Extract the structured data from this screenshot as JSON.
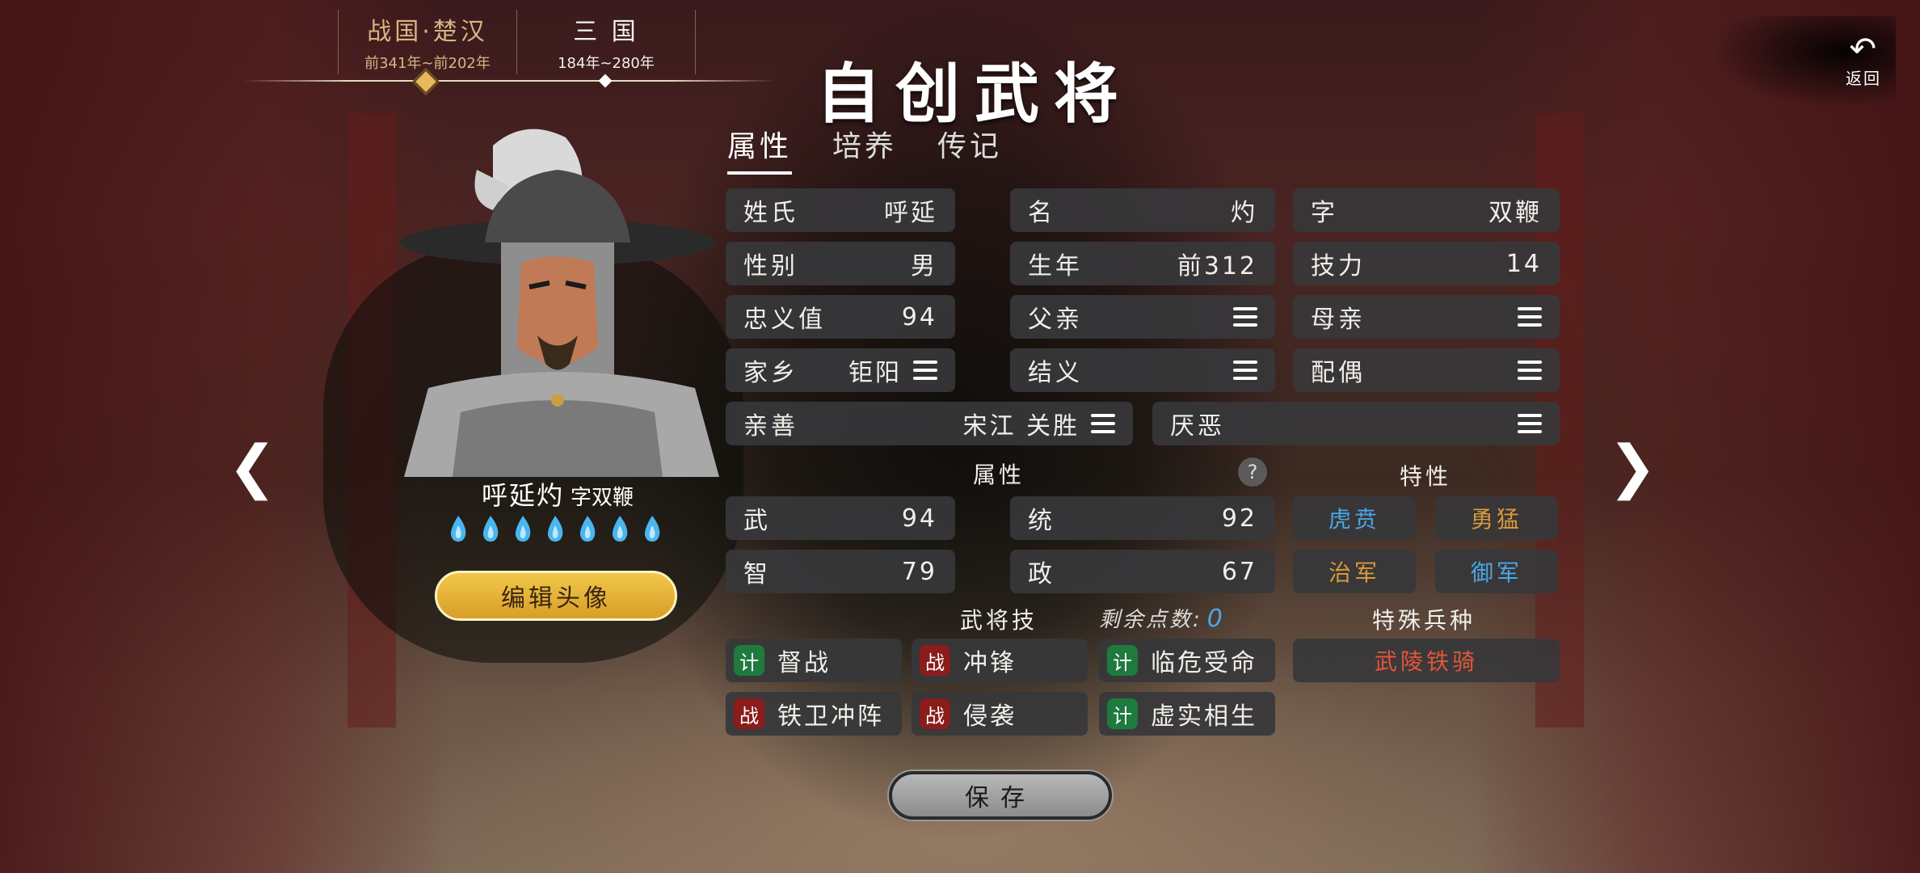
{
  "eras": [
    {
      "name": "战国·楚汉",
      "range": "前341年~前202年"
    },
    {
      "name": "三 国",
      "range": "184年~280年"
    }
  ],
  "title": "自创武将",
  "back": {
    "label": "返回"
  },
  "tabs": [
    "属性",
    "培养",
    "传记"
  ],
  "portrait": {
    "name": "呼延灼",
    "zi": "字双鞭",
    "flame_count": 7,
    "flame_color": "#49b6f0"
  },
  "edit_avatar_label": "编辑头像",
  "info": {
    "surname": {
      "k": "姓氏",
      "v": "呼延"
    },
    "given": {
      "k": "名",
      "v": "灼"
    },
    "zi": {
      "k": "字",
      "v": "双鞭"
    },
    "gender": {
      "k": "性别",
      "v": "男"
    },
    "birth": {
      "k": "生年",
      "v": "前312"
    },
    "skill_power": {
      "k": "技力",
      "v": "14"
    },
    "loyalty": {
      "k": "忠义值",
      "v": "94"
    },
    "father": {
      "k": "父亲"
    },
    "mother": {
      "k": "母亲"
    },
    "hometown": {
      "k": "家乡",
      "v": "钜阳"
    },
    "sworn": {
      "k": "结义"
    },
    "spouse": {
      "k": "配偶"
    },
    "likes": {
      "k": "亲善",
      "v": "宋江 关胜"
    },
    "dislikes": {
      "k": "厌恶"
    }
  },
  "attributes_label": "属性",
  "traits_label": "特性",
  "attrs": {
    "wu": {
      "k": "武",
      "v": "94"
    },
    "tong": {
      "k": "统",
      "v": "92"
    },
    "zhi": {
      "k": "智",
      "v": "79"
    },
    "zheng": {
      "k": "政",
      "v": "67"
    }
  },
  "traits": [
    {
      "label": "虎贲",
      "color": "#4aa6e8"
    },
    {
      "label": "勇猛",
      "color": "#d89a3a"
    },
    {
      "label": "治军",
      "color": "#d89a3a"
    },
    {
      "label": "御军",
      "color": "#4aa6e8"
    }
  ],
  "skills_label": "武将技",
  "remaining_label": "剩余点数:",
  "remaining_value": "0",
  "special_troop_label": "特殊兵种",
  "special_troop": "武陵铁骑",
  "skills": [
    {
      "type": "计",
      "name": "督战"
    },
    {
      "type": "战",
      "name": "冲锋"
    },
    {
      "type": "计",
      "name": "临危受命"
    },
    {
      "type": "战",
      "name": "铁卫冲阵"
    },
    {
      "type": "战",
      "name": "侵袭"
    },
    {
      "type": "计",
      "name": "虚实相生"
    }
  ],
  "save_label": "保存"
}
